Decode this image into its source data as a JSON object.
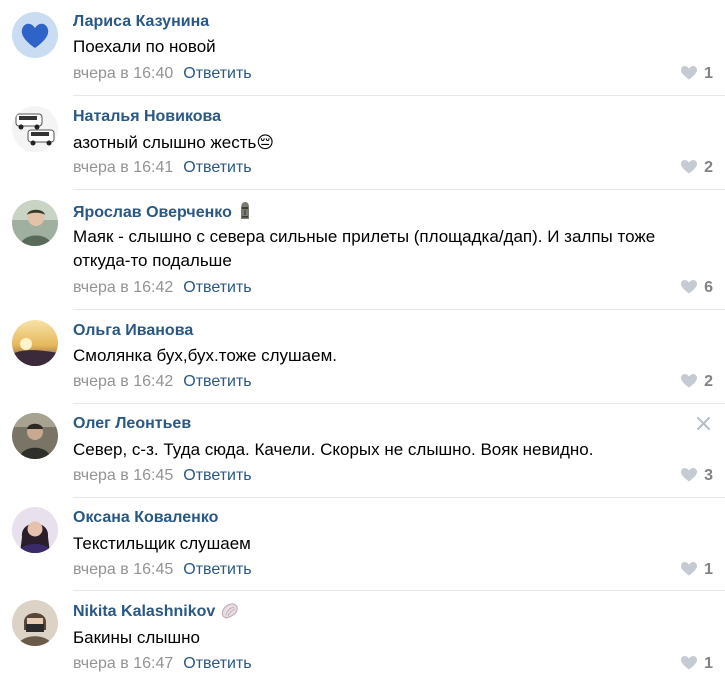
{
  "comments": [
    {
      "author": "Лариса Казунина",
      "text": "Поехали по новой",
      "date": "вчера в 16:40",
      "reply": "Ответить",
      "likes": "1",
      "avatar_icon": "heart-avatar-icon",
      "avatar_color": "#2f63c8"
    },
    {
      "author": "Наталья Новикова",
      "text": "азотный слышно жесть😔",
      "date": "вчера в 16:41",
      "reply": "Ответить",
      "likes": "2",
      "avatar_icon": "cars-avatar-icon",
      "avatar_color": "#ffffff"
    },
    {
      "author": "Ярослав Оверченко",
      "text": "Маяк - слышно с севера сильные прилеты (площадка/дап). И залпы тоже откуда-то подальше",
      "date": "вчера в 16:42",
      "reply": "Ответить",
      "likes": "6",
      "badge_icon": "moai-icon",
      "avatar_icon": "person-avatar-icon",
      "avatar_color": "#8a9a8a"
    },
    {
      "author": "Ольга Иванова",
      "text": "Смолянка бух,бух.тоже слушаем.",
      "date": "вчера в 16:42",
      "reply": "Ответить",
      "likes": "2",
      "avatar_icon": "sunset-avatar-icon",
      "avatar_color": "#e6b85c"
    },
    {
      "author": "Олег Леонтьев",
      "text": "Север, с-з. Туда сюда. Качели. Скорых не слышно. Вояк невидно.",
      "date": "вчера в 16:45",
      "reply": "Ответить",
      "likes": "3",
      "close_icon": "close-icon",
      "avatar_icon": "person-avatar-icon",
      "avatar_color": "#6a6a5a"
    },
    {
      "author": "Оксана Коваленко",
      "text": "Текстильщик слушаем",
      "date": "вчера в 16:45",
      "reply": "Ответить",
      "likes": "1",
      "avatar_icon": "woman-avatar-icon",
      "avatar_color": "#4a3a6a"
    },
    {
      "author": "Nikita Kalashnikov",
      "text": "Бакины слышно",
      "date": "вчера в 16:47",
      "reply": "Ответить",
      "likes": "1",
      "badge_icon": "shell-icon",
      "avatar_icon": "masked-person-avatar-icon",
      "avatar_color": "#d8c8b8"
    }
  ],
  "colors": {
    "author": "#2a5885",
    "meta": "#939393",
    "likes": "#828282",
    "divider": "#e7e8ec"
  }
}
